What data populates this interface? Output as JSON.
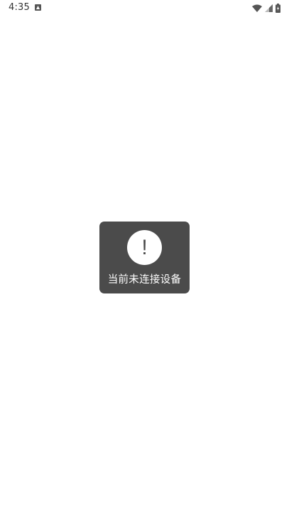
{
  "status_bar": {
    "time": "4:35",
    "notification_icon": "accessibility-notification-icon",
    "wifi_icon": "wifi-icon",
    "signal_icon": "cell-signal-icon",
    "battery_icon": "battery-icon"
  },
  "toast": {
    "icon": "exclamation-icon",
    "icon_glyph": "!",
    "message": "当前未连接设备",
    "background_color": "#4b4b4b"
  }
}
